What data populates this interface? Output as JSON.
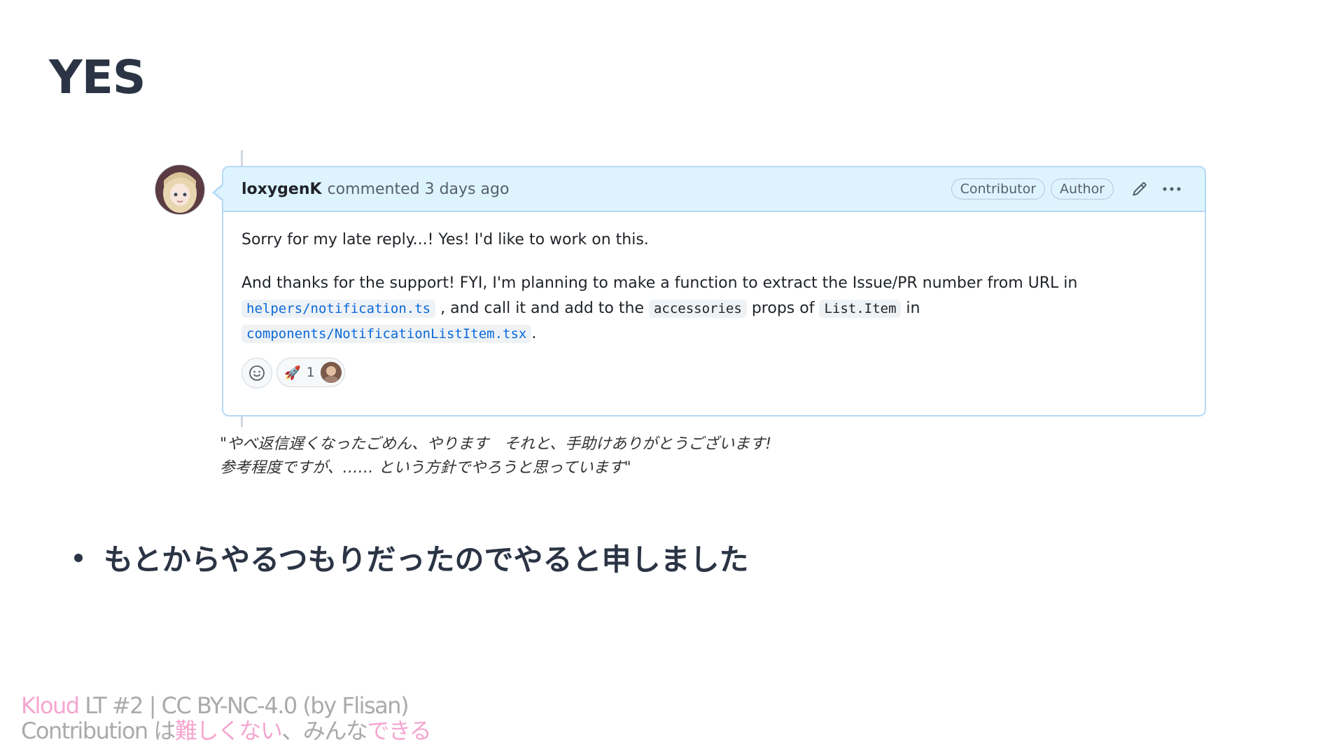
{
  "slide": {
    "title": "YES"
  },
  "comment": {
    "author": "loxygenK",
    "meta": "commented 3 days ago",
    "badges": [
      "Contributor",
      "Author"
    ],
    "body": {
      "line1": "Sorry for my late reply...! Yes! I'd like to work on this.",
      "p2_text1": "And thanks for the support! FYI, I'm planning to make a function to extract the Issue/PR number from URL in",
      "code_helpers": "helpers/notification.ts",
      "p2_text2": ", and call it and add to the",
      "code_accessories": "accessories",
      "p2_text3": "props of",
      "code_listitem": "List.Item",
      "p2_text4": "in",
      "code_component": "components/NotificationListItem.tsx",
      "p2_text5": "."
    },
    "reactions": {
      "emoji": "🚀",
      "count": "1"
    },
    "icons": {
      "edit": "pencil-icon",
      "more": "kebab-horizontal-icon",
      "add_reaction": "smiley-icon"
    }
  },
  "translation": {
    "line1": "\"やべ返信遅くなったごめん、やります　それと、手助けありがとうございます!",
    "line2": "参考程度ですが、…… という方針でやろうと思っています\""
  },
  "bullet": {
    "text": "もとからやるつもりだったのでやると申しました"
  },
  "footer": {
    "line1_brand": "Kloud",
    "line1_rest": " LT #2 | CC BY-NC-4.0 (by Flisan)",
    "line2_a": "Contribution は",
    "line2_b": "難しくない",
    "line2_c": "、みんな",
    "line2_d": "できる"
  },
  "colors": {
    "header_bg": "#ddf4ff",
    "border": "#b6d9f5",
    "link": "#0969da",
    "accent_pink": "#f4a6d0"
  }
}
